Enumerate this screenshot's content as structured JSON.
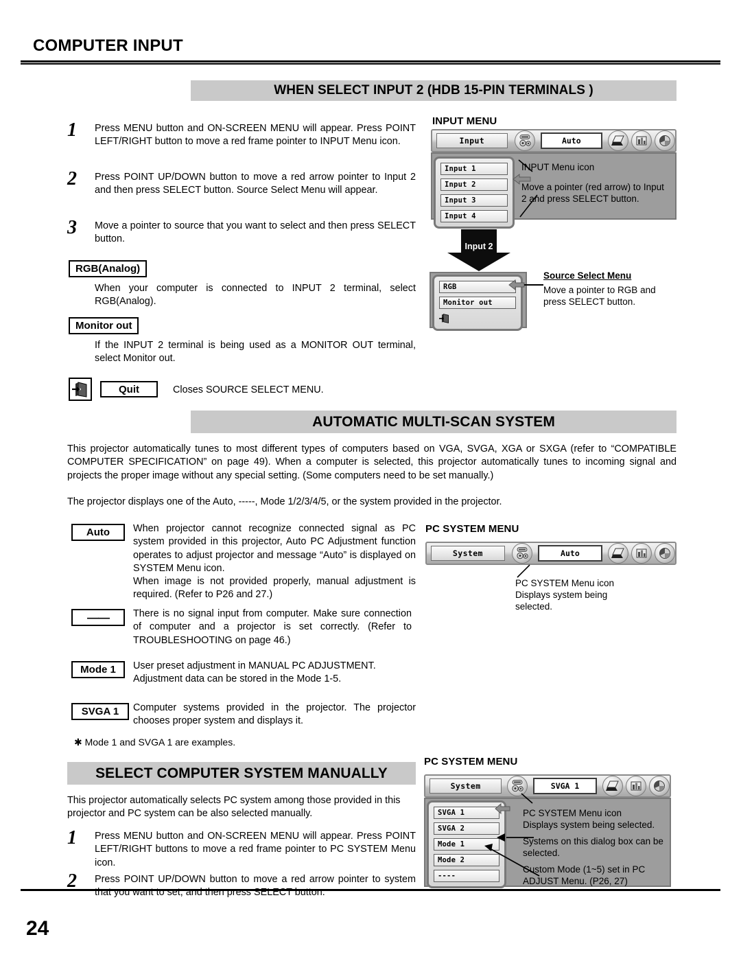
{
  "document": {
    "page_title": "COMPUTER INPUT",
    "page_number": "24"
  },
  "sections": {
    "input2": {
      "header": "WHEN SELECT INPUT 2 (HDB 15-PIN TERMINALS )",
      "steps": [
        {
          "num": "1",
          "text": "Press MENU button and ON-SCREEN MENU will appear.  Press POINT LEFT/RIGHT button to move a red frame pointer to INPUT Menu icon."
        },
        {
          "num": "2",
          "text": "Press POINT UP/DOWN button to move a red arrow pointer to Input 2 and then press SELECT button.  Source Select Menu will appear."
        },
        {
          "num": "3",
          "text": "Move a pointer to source that you want to select and then press SELECT button."
        }
      ],
      "rgb_label": "RGB(Analog)",
      "rgb_text": "When your computer is connected to INPUT 2 terminal, select RGB(Analog).",
      "monitor_label": "Monitor out",
      "monitor_text": "If the INPUT 2 terminal is being used as a MONITOR OUT terminal, select Monitor out.",
      "quit_label": "Quit",
      "quit_text": "Closes SOURCE SELECT MENU.",
      "quit_icon": "exit-door-icon"
    },
    "autoscan": {
      "header": "AUTOMATIC MULTI-SCAN SYSTEM",
      "para1": "This projector automatically tunes to most different types of computers based on VGA, SVGA, XGA or SXGA (refer to “COMPATIBLE COMPUTER SPECIFICATION” on page 49).  When a computer is selected, this projector automatically tunes to incoming signal and projects the proper image without any special setting.  (Some computers need to be set manually.)",
      "para2": "The projector displays one of the Auto, -----, Mode 1/2/3/4/5, or the system provided in the projector.",
      "items": [
        {
          "label": "Auto",
          "text": "When projector cannot recognize connected signal as PC system provided in this projector, Auto PC Adjustment function operates to adjust projector and message “Auto” is displayed on SYSTEM Menu icon.\nWhen image is not provided properly, manual adjustment is required.  (Refer to P26 and 27.)"
        },
        {
          "label": "——",
          "text": "There is no signal input from computer.  Make sure connection of computer and a projector is set correctly.  (Refer to TROUBLESHOOTING on page 46.)"
        },
        {
          "label": "Mode 1",
          "text": "User preset adjustment in MANUAL PC ADJUSTMENT. Adjustment data can be stored in the Mode 1-5."
        },
        {
          "label": "SVGA 1",
          "text": "Computer systems provided in the projector. The projector chooses proper system and displays it."
        }
      ],
      "footnote": "✱   Mode 1 and SVGA 1 are examples."
    },
    "manual": {
      "header": "SELECT COMPUTER SYSTEM MANUALLY",
      "intro": "This projector automatically selects PC system among those provided in this projector and PC system can be also selected manually.",
      "steps": [
        {
          "num": "1",
          "text": "Press MENU button and ON-SCREEN MENU will appear.  Press POINT LEFT/RIGHT buttons to move a red frame pointer to PC SYSTEM Menu icon."
        },
        {
          "num": "2",
          "text": "Press POINT UP/DOWN button to move a red arrow pointer to system that you want to set, and then press SELECT button."
        }
      ]
    }
  },
  "osd": {
    "input_menu": {
      "title": "INPUT MENU",
      "tab_label": "Input",
      "value_label": "Auto",
      "icons": [
        "computer-input-icon",
        "laptop-icon",
        "image-adjust-icon",
        "color-wheel-icon"
      ],
      "list_items": [
        "Input 1",
        "Input 2",
        "Input 3",
        "Input 4"
      ],
      "callout_icon": "INPUT Menu icon",
      "callout_pointer": "Move a pointer (red arrow) to Input 2 and press SELECT button.",
      "arrow_icon": "left-arrow-pointer-icon"
    },
    "source_select": {
      "flow_label": "Input 2",
      "list_items": [
        "RGB",
        "Monitor out"
      ],
      "quit_icon": "exit-door-icon",
      "callout_title": "Source Select Menu",
      "callout_text": "Move a pointer to RGB and press SELECT button.",
      "arrow_icon": "left-arrow-pointer-icon"
    },
    "pc_system_auto": {
      "title": "PC SYSTEM MENU",
      "tab_label": "System",
      "value_label": "Auto",
      "callout": "PC SYSTEM Menu icon\nDisplays system being\nselected."
    },
    "pc_system_manual": {
      "title": "PC SYSTEM MENU",
      "tab_label": "System",
      "value_label": "SVGA 1",
      "list_items": [
        "SVGA 1",
        "SVGA 2",
        "Mode 1",
        "Mode 2",
        "----"
      ],
      "callout1": "PC SYSTEM Menu icon\nDisplays system being selected.",
      "callout2": "Systems on this dialog box can be selected.",
      "callout3": "Custom Mode (1~5) set in PC ADJUST Menu.  (P26, 27)",
      "arrow_icon": "left-arrow-pointer-icon"
    }
  },
  "colors": {
    "header_bar": "#c9c9c9",
    "text": "#000000",
    "osd_panel": "#9d9d9d"
  }
}
